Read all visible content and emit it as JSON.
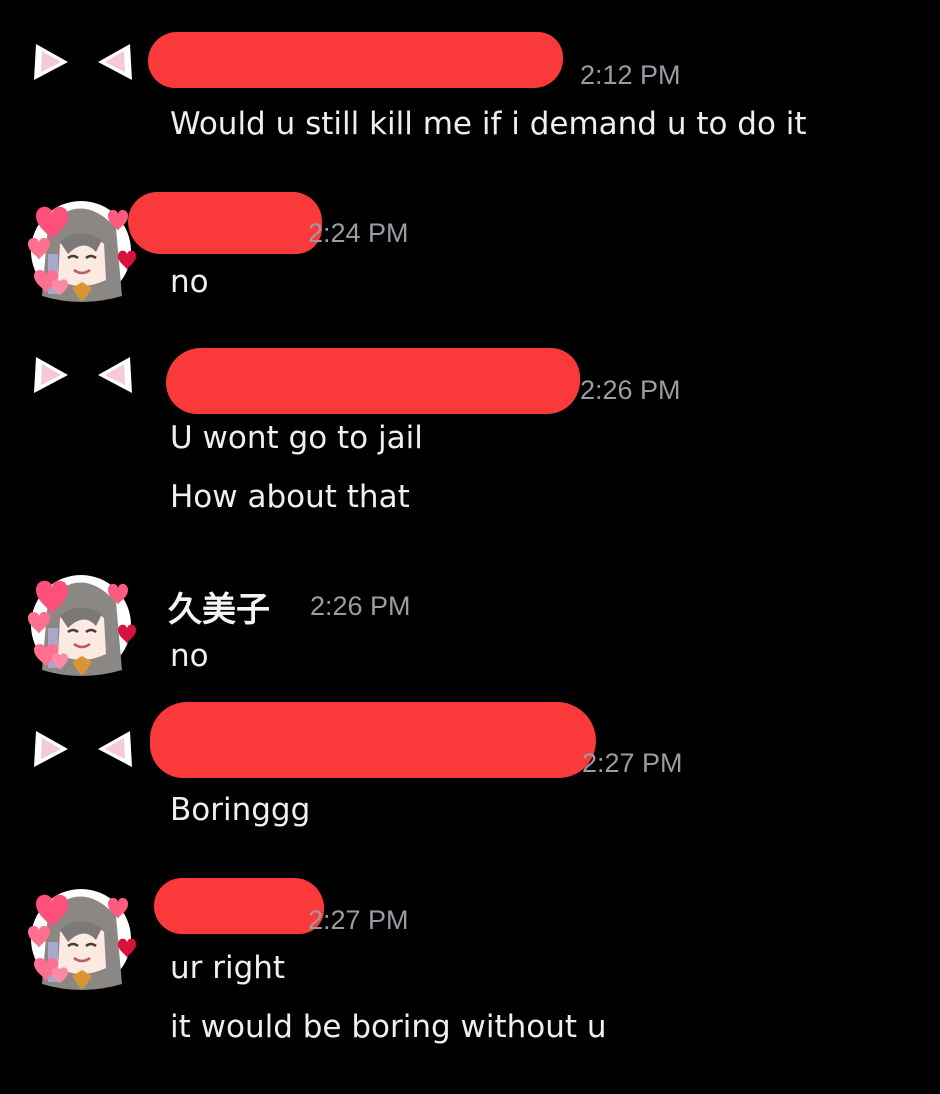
{
  "colors": {
    "background": "#000000",
    "text": "#eeeff1",
    "timestamp": "#9b9ca3",
    "redaction": "#fa3a3a"
  },
  "messages": [
    {
      "author": "",
      "time": "2:12 PM",
      "avatar": "cat-ears-avatar",
      "redacted": true,
      "lines": [
        "Would u still kill me if i demand u to do it"
      ]
    },
    {
      "author": "",
      "time": "2:24 PM",
      "avatar": "anime-girl-hearts-avatar",
      "redacted": true,
      "lines": [
        "no"
      ]
    },
    {
      "author": "",
      "time": "2:26 PM",
      "avatar": "cat-ears-avatar",
      "redacted": true,
      "lines": [
        "U wont go to jail",
        "How about that"
      ]
    },
    {
      "author": "久美子",
      "time": "2:26 PM",
      "avatar": "anime-girl-hearts-avatar",
      "redacted": false,
      "lines": [
        "no"
      ]
    },
    {
      "author": "",
      "time": "2:27 PM",
      "avatar": "cat-ears-avatar",
      "redacted": true,
      "lines": [
        "Boringgg"
      ]
    },
    {
      "author": "",
      "time": "2:27 PM",
      "avatar": "anime-girl-hearts-avatar",
      "redacted": true,
      "lines": [
        "ur right",
        "it would be boring without u"
      ]
    }
  ]
}
